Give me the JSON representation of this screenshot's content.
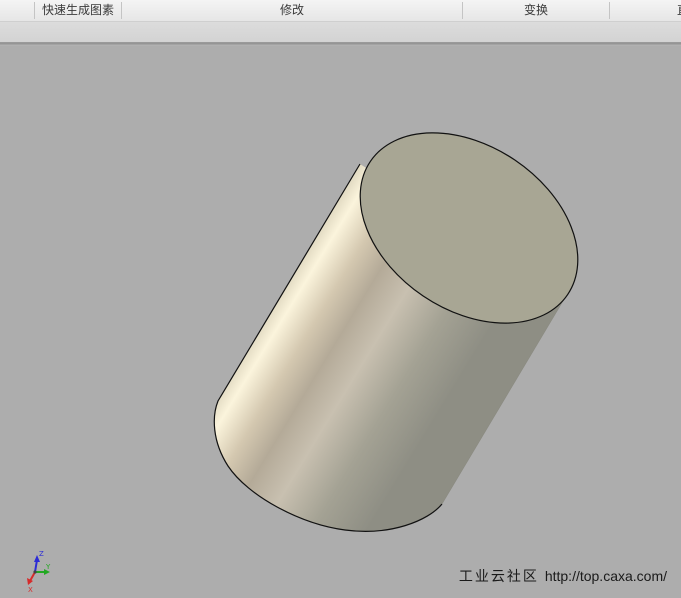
{
  "ribbon": {
    "groups": [
      {
        "label": "快速生成图素"
      },
      {
        "label": "修改"
      },
      {
        "label": "变换"
      },
      {
        "label": "直"
      }
    ]
  },
  "viewport": {
    "object": "cylinder-solid",
    "background_color": "#adadad",
    "top_face_color": "#a8a694",
    "edge_color": "#111111"
  },
  "triad": {
    "z_label": "Z",
    "y_label": "Y",
    "x_label": "X",
    "z_color": "#2b2bd6",
    "y_color": "#22a822",
    "x_color": "#d62b2b"
  },
  "watermark": {
    "brand": "工业云社区",
    "url": "http://top.caxa.com/"
  }
}
